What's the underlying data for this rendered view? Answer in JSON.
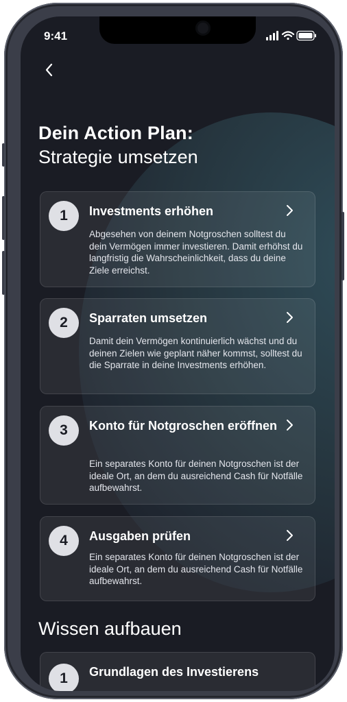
{
  "status": {
    "time": "9:41"
  },
  "header": {
    "title_line1": "Dein Action Plan:",
    "title_line2": "Strategie umsetzen"
  },
  "cards": [
    {
      "number": "1",
      "title": "Investments erhöhen",
      "description": "Abgesehen von deinem Notgroschen solltest du dein Vermögen immer investieren. Damit erhöhst du langfristig die Wahrscheinlichkeit, dass du deine Ziele erreichst."
    },
    {
      "number": "2",
      "title": "Sparraten umsetzen",
      "description": "Damit dein Vermögen kontinuierlich wächst und du deinen Zielen wie geplant näher kommst, solltest du die Sparrate in deine Investments erhöhen."
    },
    {
      "number": "3",
      "title": "Konto für Notgroschen eröffnen",
      "description": "Ein separates Konto für deinen Notgroschen ist der ideale Ort, an dem du ausreichend Cash für Notfälle aufbewahrst."
    },
    {
      "number": "4",
      "title": "Ausgaben prüfen",
      "description": "Ein separates Konto für deinen Notgroschen ist der ideale Ort, an dem du ausreichend Cash für Notfälle aufbewahrst."
    }
  ],
  "knowledge": {
    "heading": "Wissen aufbauen",
    "items": [
      {
        "number": "1",
        "title": "Grundlagen des Investierens"
      }
    ]
  },
  "icons": [
    "back-arrow-icon",
    "chevron-right-icon",
    "signal-icon",
    "wifi-icon",
    "battery-icon"
  ],
  "colors": {
    "background": "#1a1c24",
    "accent_glow": "#2f4c58",
    "text": "#ffffff"
  }
}
